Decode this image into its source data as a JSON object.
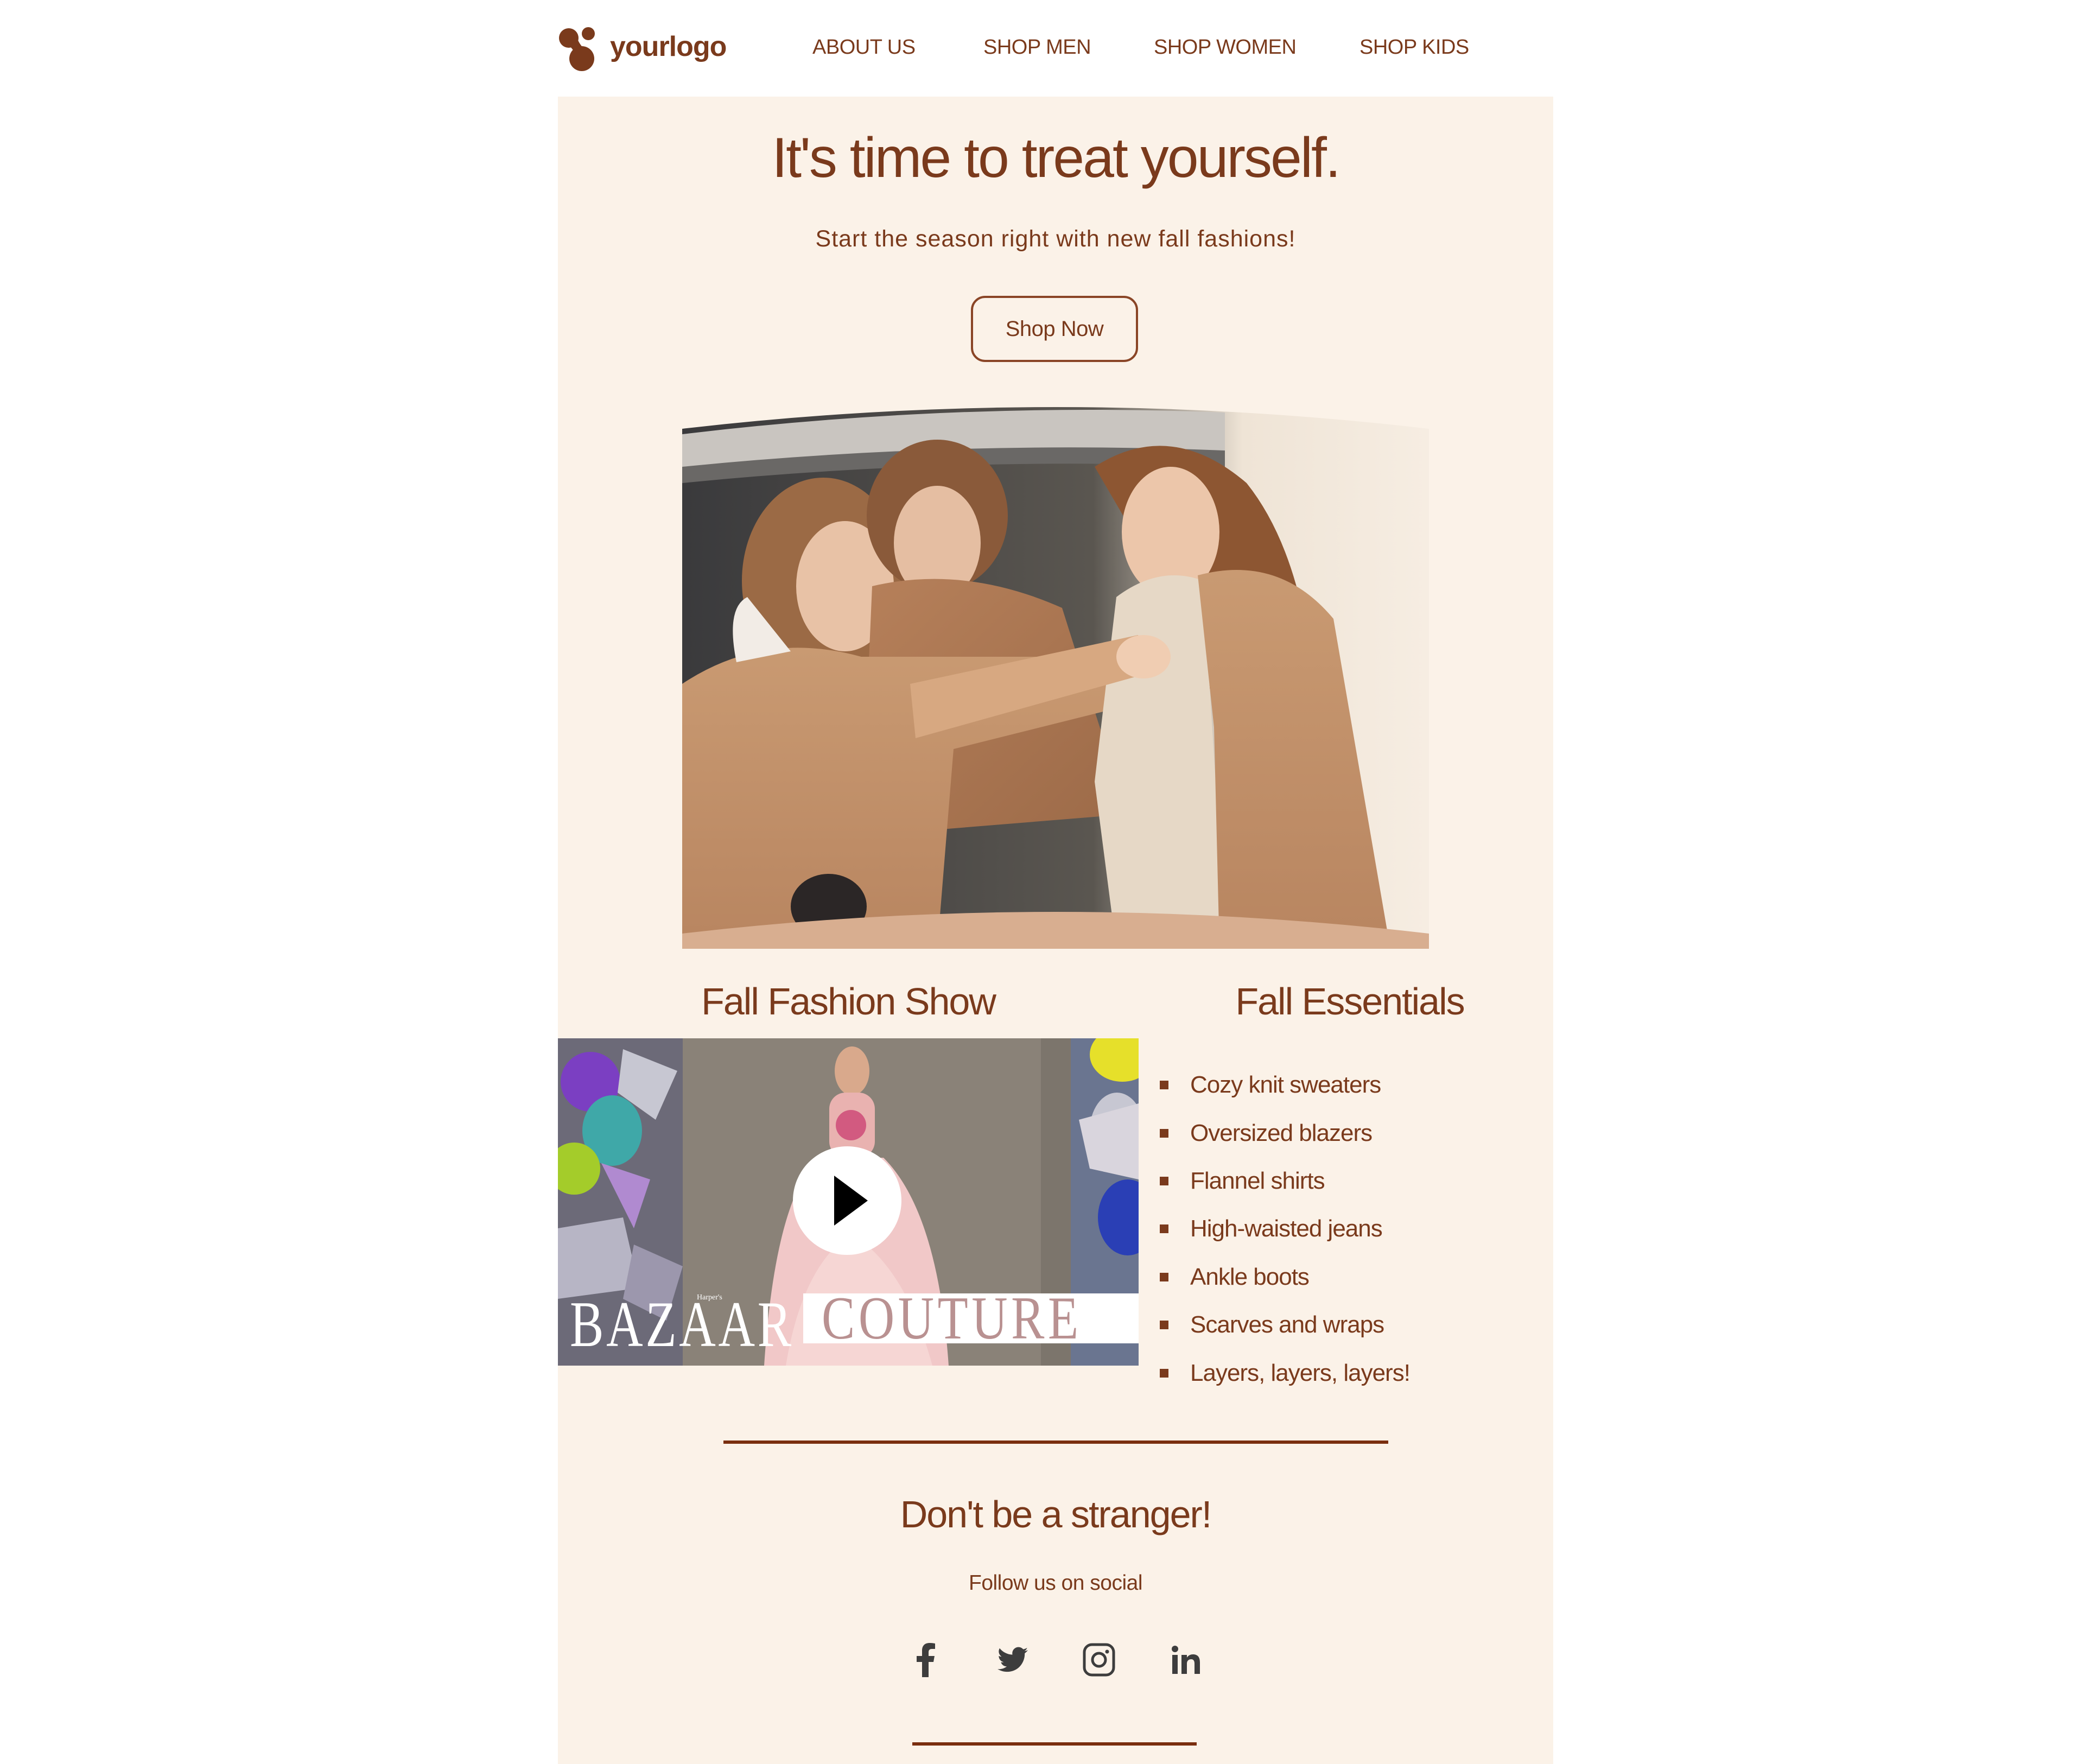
{
  "header": {
    "logo_text": "yourlogo",
    "nav": [
      "ABOUT US",
      "SHOP MEN",
      "SHOP WOMEN",
      "SHOP KIDS"
    ]
  },
  "hero": {
    "title": "It's time to treat yourself.",
    "subtitle": "Start the season right with new fall fashions!",
    "cta_label": "Shop Now",
    "image_alt": "Three women in camel coats laughing beside an open car"
  },
  "fashion_show": {
    "title": "Fall Fashion Show",
    "video": {
      "brand_small": "Harper's",
      "brand": "BAZAAR",
      "label": "COUTURE",
      "play_icon": "play-icon"
    }
  },
  "essentials": {
    "title": "Fall Essentials",
    "items": [
      "Cozy knit sweaters",
      "Oversized blazers",
      "Flannel shirts",
      "High-waisted jeans",
      "Ankle boots",
      "Scarves and wraps",
      "Layers, layers, layers!"
    ]
  },
  "footer": {
    "title": "Don't be a stranger!",
    "follow_text": "Follow us on social",
    "social": [
      {
        "name": "facebook",
        "icon": "facebook-icon"
      },
      {
        "name": "twitter",
        "icon": "twitter-icon"
      },
      {
        "name": "instagram",
        "icon": "instagram-icon"
      },
      {
        "name": "linkedin",
        "icon": "linkedin-icon"
      }
    ]
  },
  "colors": {
    "brand_brown": "#7a3a1c",
    "panel_bg": "#fbf2e8",
    "divider": "#7a2e0e",
    "hero_band": "#d8ae90",
    "icon_gray": "#3d3d3d"
  }
}
